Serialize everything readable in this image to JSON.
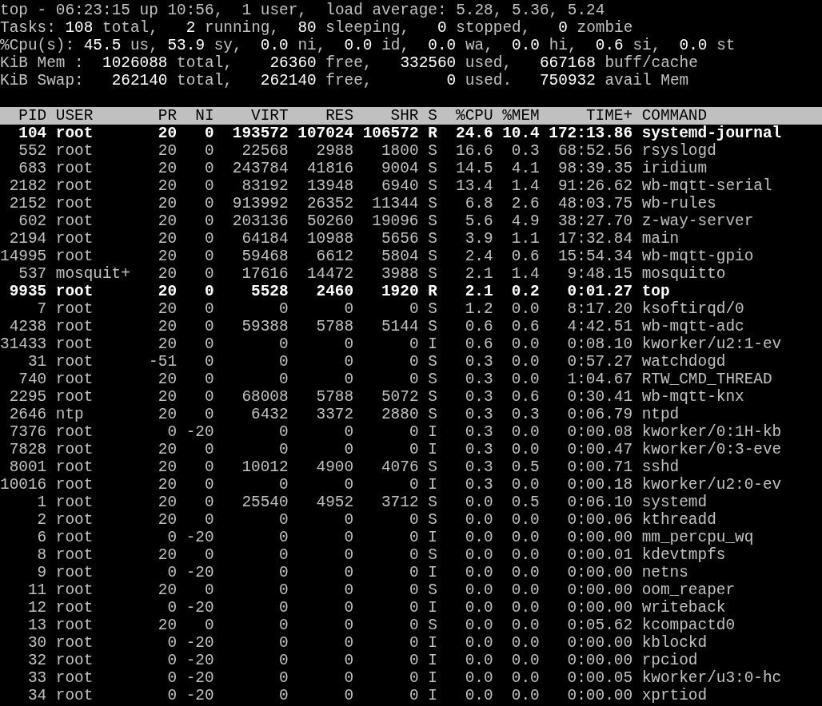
{
  "summary": [
    "top - 06:23:15 up 10:56,  1 user,  load average: 5.28, 5.36, 5.24",
    "Tasks: **108** total,   **2** running,  **80** sleeping,   **0** stopped,   **0** zombie",
    "%Cpu(s): **45.5** us, **53.9** sy,  **0.0** ni,  **0.0** id,  **0.0** wa,  **0.0** hi,  **0.6** si,  **0.0** st",
    "KiB Mem :  **1026088** total,    **26360** free,   **332560** used,   **667168** buff/cache",
    "KiB Swap:   **262140** total,   **262140** free,        **0** used.   **750932** avail Mem"
  ],
  "table": {
    "columns": [
      "PID",
      "USER",
      "PR",
      "NI",
      "VIRT",
      "RES",
      "SHR",
      "S",
      "%CPU",
      "%MEM",
      "TIME+",
      "COMMAND"
    ],
    "rows": [
      {
        "bold": true,
        "cells": [
          "104",
          "root",
          "20",
          "0",
          "193572",
          "107024",
          "106572",
          "R",
          "24.6",
          "10.4",
          "172:13.86",
          "systemd-journal"
        ]
      },
      {
        "bold": false,
        "cells": [
          "552",
          "root",
          "20",
          "0",
          "22568",
          "2988",
          "1800",
          "S",
          "16.6",
          "0.3",
          "68:52.56",
          "rsyslogd"
        ]
      },
      {
        "bold": false,
        "cells": [
          "683",
          "root",
          "20",
          "0",
          "243784",
          "41816",
          "9004",
          "S",
          "14.5",
          "4.1",
          "98:39.35",
          "iridium"
        ]
      },
      {
        "bold": false,
        "cells": [
          "2182",
          "root",
          "20",
          "0",
          "83192",
          "13948",
          "6940",
          "S",
          "13.4",
          "1.4",
          "91:26.62",
          "wb-mqtt-serial"
        ]
      },
      {
        "bold": false,
        "cells": [
          "2152",
          "root",
          "20",
          "0",
          "913992",
          "26352",
          "11344",
          "S",
          "6.8",
          "2.6",
          "48:03.75",
          "wb-rules"
        ]
      },
      {
        "bold": false,
        "cells": [
          "602",
          "root",
          "20",
          "0",
          "203136",
          "50260",
          "19096",
          "S",
          "5.6",
          "4.9",
          "38:27.70",
          "z-way-server"
        ]
      },
      {
        "bold": false,
        "cells": [
          "2194",
          "root",
          "20",
          "0",
          "64184",
          "10988",
          "5656",
          "S",
          "3.9",
          "1.1",
          "17:32.84",
          "main"
        ]
      },
      {
        "bold": false,
        "cells": [
          "14995",
          "root",
          "20",
          "0",
          "59468",
          "6612",
          "5804",
          "S",
          "2.4",
          "0.6",
          "15:54.34",
          "wb-mqtt-gpio"
        ]
      },
      {
        "bold": false,
        "cells": [
          "537",
          "mosquit+",
          "20",
          "0",
          "17616",
          "14472",
          "3988",
          "S",
          "2.1",
          "1.4",
          "9:48.15",
          "mosquitto"
        ]
      },
      {
        "bold": true,
        "cells": [
          "9935",
          "root",
          "20",
          "0",
          "5528",
          "2460",
          "1920",
          "R",
          "2.1",
          "0.2",
          "0:01.27",
          "top"
        ]
      },
      {
        "bold": false,
        "cells": [
          "7",
          "root",
          "20",
          "0",
          "0",
          "0",
          "0",
          "S",
          "1.2",
          "0.0",
          "8:17.20",
          "ksoftirqd/0"
        ]
      },
      {
        "bold": false,
        "cells": [
          "4238",
          "root",
          "20",
          "0",
          "59388",
          "5788",
          "5144",
          "S",
          "0.6",
          "0.6",
          "4:42.51",
          "wb-mqtt-adc"
        ]
      },
      {
        "bold": false,
        "cells": [
          "31433",
          "root",
          "20",
          "0",
          "0",
          "0",
          "0",
          "I",
          "0.6",
          "0.0",
          "0:08.10",
          "kworker/u2:1-ev"
        ]
      },
      {
        "bold": false,
        "cells": [
          "31",
          "root",
          "-51",
          "0",
          "0",
          "0",
          "0",
          "S",
          "0.3",
          "0.0",
          "0:57.27",
          "watchdogd"
        ]
      },
      {
        "bold": false,
        "cells": [
          "740",
          "root",
          "20",
          "0",
          "0",
          "0",
          "0",
          "S",
          "0.3",
          "0.0",
          "1:04.67",
          "RTW_CMD_THREAD"
        ]
      },
      {
        "bold": false,
        "cells": [
          "2295",
          "root",
          "20",
          "0",
          "68008",
          "5788",
          "5072",
          "S",
          "0.3",
          "0.6",
          "0:30.41",
          "wb-mqtt-knx"
        ]
      },
      {
        "bold": false,
        "cells": [
          "2646",
          "ntp",
          "20",
          "0",
          "6432",
          "3372",
          "2880",
          "S",
          "0.3",
          "0.3",
          "0:06.79",
          "ntpd"
        ]
      },
      {
        "bold": false,
        "cells": [
          "7376",
          "root",
          "0",
          "-20",
          "0",
          "0",
          "0",
          "I",
          "0.3",
          "0.0",
          "0:00.08",
          "kworker/0:1H-kb"
        ]
      },
      {
        "bold": false,
        "cells": [
          "7828",
          "root",
          "20",
          "0",
          "0",
          "0",
          "0",
          "I",
          "0.3",
          "0.0",
          "0:00.47",
          "kworker/0:3-eve"
        ]
      },
      {
        "bold": false,
        "cells": [
          "8001",
          "root",
          "20",
          "0",
          "10012",
          "4900",
          "4076",
          "S",
          "0.3",
          "0.5",
          "0:00.71",
          "sshd"
        ]
      },
      {
        "bold": false,
        "cells": [
          "10016",
          "root",
          "20",
          "0",
          "0",
          "0",
          "0",
          "I",
          "0.3",
          "0.0",
          "0:00.18",
          "kworker/u2:0-ev"
        ]
      },
      {
        "bold": false,
        "cells": [
          "1",
          "root",
          "20",
          "0",
          "25540",
          "4952",
          "3712",
          "S",
          "0.0",
          "0.5",
          "0:06.10",
          "systemd"
        ]
      },
      {
        "bold": false,
        "cells": [
          "2",
          "root",
          "20",
          "0",
          "0",
          "0",
          "0",
          "S",
          "0.0",
          "0.0",
          "0:00.06",
          "kthreadd"
        ]
      },
      {
        "bold": false,
        "cells": [
          "6",
          "root",
          "0",
          "-20",
          "0",
          "0",
          "0",
          "I",
          "0.0",
          "0.0",
          "0:00.00",
          "mm_percpu_wq"
        ]
      },
      {
        "bold": false,
        "cells": [
          "8",
          "root",
          "20",
          "0",
          "0",
          "0",
          "0",
          "S",
          "0.0",
          "0.0",
          "0:00.01",
          "kdevtmpfs"
        ]
      },
      {
        "bold": false,
        "cells": [
          "9",
          "root",
          "0",
          "-20",
          "0",
          "0",
          "0",
          "I",
          "0.0",
          "0.0",
          "0:00.00",
          "netns"
        ]
      },
      {
        "bold": false,
        "cells": [
          "11",
          "root",
          "20",
          "0",
          "0",
          "0",
          "0",
          "S",
          "0.0",
          "0.0",
          "0:00.00",
          "oom_reaper"
        ]
      },
      {
        "bold": false,
        "cells": [
          "12",
          "root",
          "0",
          "-20",
          "0",
          "0",
          "0",
          "I",
          "0.0",
          "0.0",
          "0:00.00",
          "writeback"
        ]
      },
      {
        "bold": false,
        "cells": [
          "13",
          "root",
          "20",
          "0",
          "0",
          "0",
          "0",
          "S",
          "0.0",
          "0.0",
          "0:05.62",
          "kcompactd0"
        ]
      },
      {
        "bold": false,
        "cells": [
          "30",
          "root",
          "0",
          "-20",
          "0",
          "0",
          "0",
          "I",
          "0.0",
          "0.0",
          "0:00.00",
          "kblockd"
        ]
      },
      {
        "bold": false,
        "cells": [
          "32",
          "root",
          "0",
          "-20",
          "0",
          "0",
          "0",
          "I",
          "0.0",
          "0.0",
          "0:00.00",
          "rpciod"
        ]
      },
      {
        "bold": false,
        "cells": [
          "33",
          "root",
          "0",
          "-20",
          "0",
          "0",
          "0",
          "I",
          "0.0",
          "0.0",
          "0:00.05",
          "kworker/u3:0-hc"
        ]
      },
      {
        "bold": false,
        "cells": [
          "34",
          "root",
          "0",
          "-20",
          "0",
          "0",
          "0",
          "I",
          "0.0",
          "0.0",
          "0:00.00",
          "xprtiod"
        ]
      }
    ]
  }
}
